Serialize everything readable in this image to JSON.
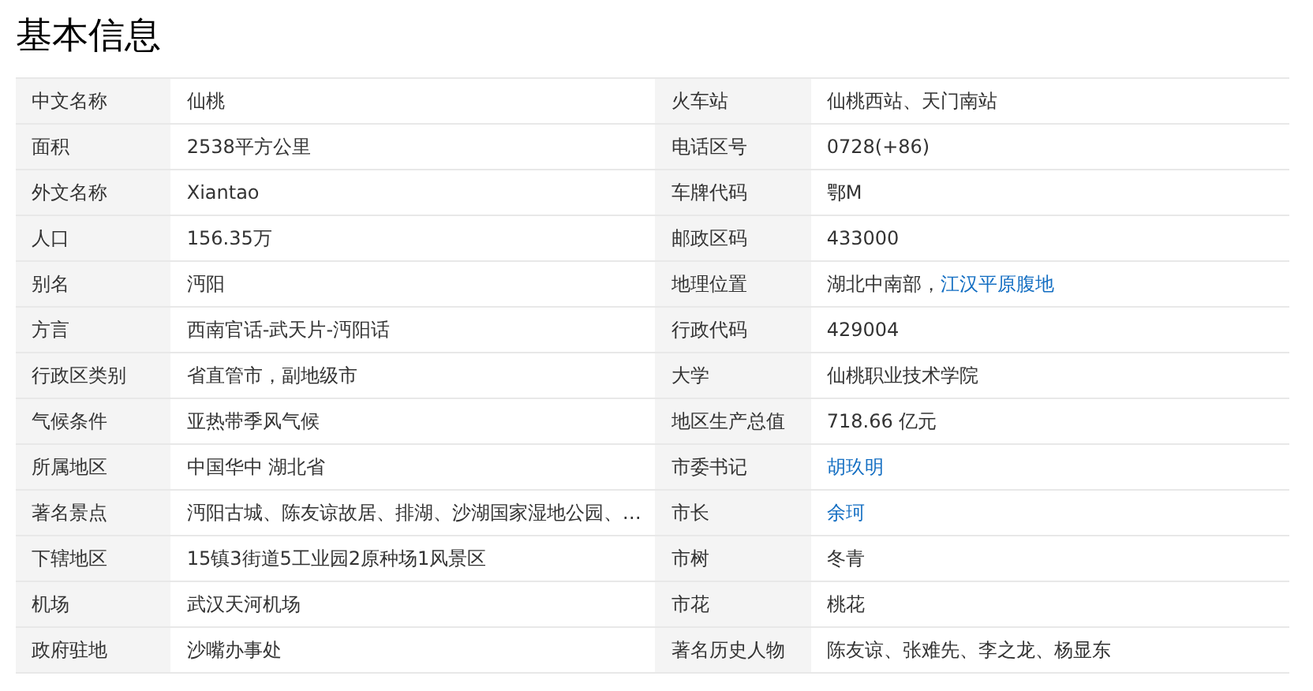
{
  "title": "基本信息",
  "rows": [
    {
      "left": {
        "label": "中文名称",
        "value": [
          {
            "text": "仙桃",
            "link": false
          }
        ]
      },
      "right": {
        "label": "火车站",
        "value": [
          {
            "text": "仙桃西站、天门南站",
            "link": false
          }
        ]
      }
    },
    {
      "left": {
        "label": "面积",
        "value": [
          {
            "text": "2538平方公里",
            "link": false
          }
        ]
      },
      "right": {
        "label": "电话区号",
        "value": [
          {
            "text": "0728(+86)",
            "link": false
          }
        ]
      }
    },
    {
      "left": {
        "label": "外文名称",
        "value": [
          {
            "text": "Xiantao",
            "link": false
          }
        ]
      },
      "right": {
        "label": "车牌代码",
        "value": [
          {
            "text": "鄂M",
            "link": false
          }
        ]
      }
    },
    {
      "left": {
        "label": "人口",
        "value": [
          {
            "text": "156.35万",
            "link": false
          }
        ]
      },
      "right": {
        "label": "邮政区码",
        "value": [
          {
            "text": "433000",
            "link": false
          }
        ]
      }
    },
    {
      "left": {
        "label": "别名",
        "value": [
          {
            "text": "沔阳",
            "link": false
          }
        ]
      },
      "right": {
        "label": "地理位置",
        "value": [
          {
            "text": "湖北中南部，",
            "link": false
          },
          {
            "text": "江汉平原腹地",
            "link": true
          }
        ]
      }
    },
    {
      "left": {
        "label": "方言",
        "value": [
          {
            "text": "西南官话-武天片-沔阳话",
            "link": false
          }
        ]
      },
      "right": {
        "label": "行政代码",
        "value": [
          {
            "text": "429004",
            "link": false
          }
        ]
      }
    },
    {
      "left": {
        "label": "行政区类别",
        "value": [
          {
            "text": "省直管市，副地级市",
            "link": false
          }
        ]
      },
      "right": {
        "label": "大学",
        "value": [
          {
            "text": "仙桃职业技术学院",
            "link": false
          }
        ]
      }
    },
    {
      "left": {
        "label": "气候条件",
        "value": [
          {
            "text": "亚热带季风气候",
            "link": false
          }
        ]
      },
      "right": {
        "label": "地区生产总值",
        "value": [
          {
            "text": "718.66 亿元",
            "link": false
          }
        ]
      }
    },
    {
      "left": {
        "label": "所属地区",
        "value": [
          {
            "text": "中国华中 湖北省",
            "link": false
          }
        ]
      },
      "right": {
        "label": "市委书记",
        "value": [
          {
            "text": "胡玖明",
            "link": true
          }
        ]
      }
    },
    {
      "left": {
        "label": "著名景点",
        "value": [
          {
            "text": "沔阳古城、陈友谅故居、排湖、沙湖国家湿地公园、…",
            "link": false
          }
        ]
      },
      "right": {
        "label": "市长",
        "value": [
          {
            "text": "余珂",
            "link": true
          }
        ]
      }
    },
    {
      "left": {
        "label": "下辖地区",
        "value": [
          {
            "text": "15镇3街道5工业园2原种场1风景区",
            "link": false
          }
        ]
      },
      "right": {
        "label": "市树",
        "value": [
          {
            "text": "冬青",
            "link": false
          }
        ]
      }
    },
    {
      "left": {
        "label": "机场",
        "value": [
          {
            "text": "武汉天河机场",
            "link": false
          }
        ]
      },
      "right": {
        "label": "市花",
        "value": [
          {
            "text": "桃花",
            "link": false
          }
        ]
      }
    },
    {
      "left": {
        "label": "政府驻地",
        "value": [
          {
            "text": "沙嘴办事处",
            "link": false
          }
        ]
      },
      "right": {
        "label": "著名历史人物",
        "value": [
          {
            "text": "陈友谅、张难先、李之龙、杨显东",
            "link": false
          }
        ]
      }
    }
  ]
}
